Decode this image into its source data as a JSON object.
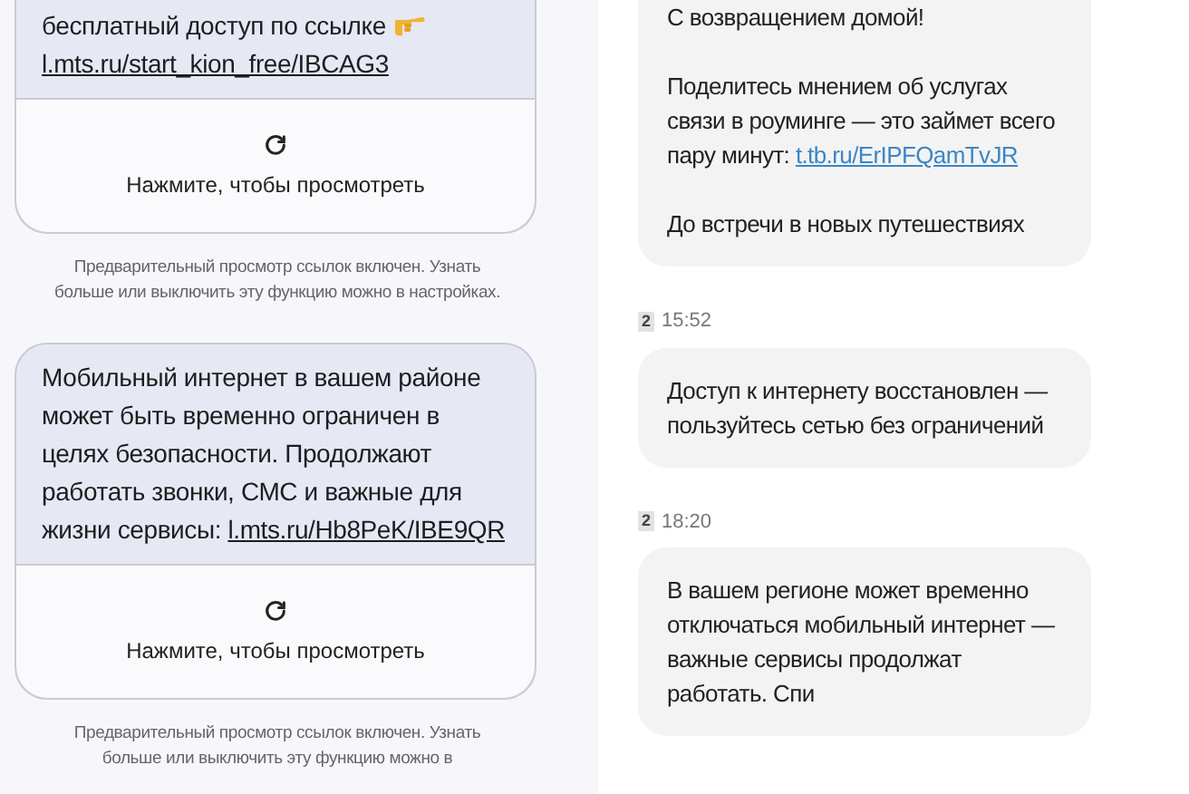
{
  "left_panel": {
    "messages": [
      {
        "text": "бесплатный доступ по ссылке",
        "pointer_emoji": true,
        "link": "l.mts.ru/start_kion_free/IBCAG3",
        "preview": {
          "label": "Нажмите, чтобы просмотреть"
        },
        "notice": "Предварительный просмотр ссылок включен. Узнать больше или выключить эту функцию можно в настройках."
      },
      {
        "text": "Мобильный интернет в вашем районе может быть временно ограничен в целях безопасности. Продолжают работать звонки, СМС и важные для жизни сервисы:",
        "pointer_emoji": false,
        "link": "l.mts.ru/Hb8PeK/IBE9QR",
        "preview": {
          "label": "Нажмите, чтобы просмотреть"
        },
        "notice": "Предварительный просмотр ссылок включен. Узнать больше или выключить эту функцию можно в"
      }
    ]
  },
  "right_panel": {
    "messages": [
      {
        "paragraphs": [
          {
            "text": "С возвращением домой!"
          },
          {
            "text": "Поделитесь мнением об услугах связи в роуминге — это займет всего пару минут:",
            "link": "t.tb.ru/ErIPFQamTvJR"
          },
          {
            "text": "До встречи в новых путешествиях"
          }
        ]
      },
      {
        "sim": "2",
        "time": "15:52",
        "paragraphs": [
          {
            "text": "Доступ к интернету восстановлен — пользуйтесь сетью без ограничений"
          }
        ]
      },
      {
        "sim": "2",
        "time": "18:20",
        "paragraphs": [
          {
            "text": "В вашем регионе может временно отключаться мобильный интернет — важные сервисы продолжат работать. Спи"
          }
        ]
      }
    ]
  }
}
